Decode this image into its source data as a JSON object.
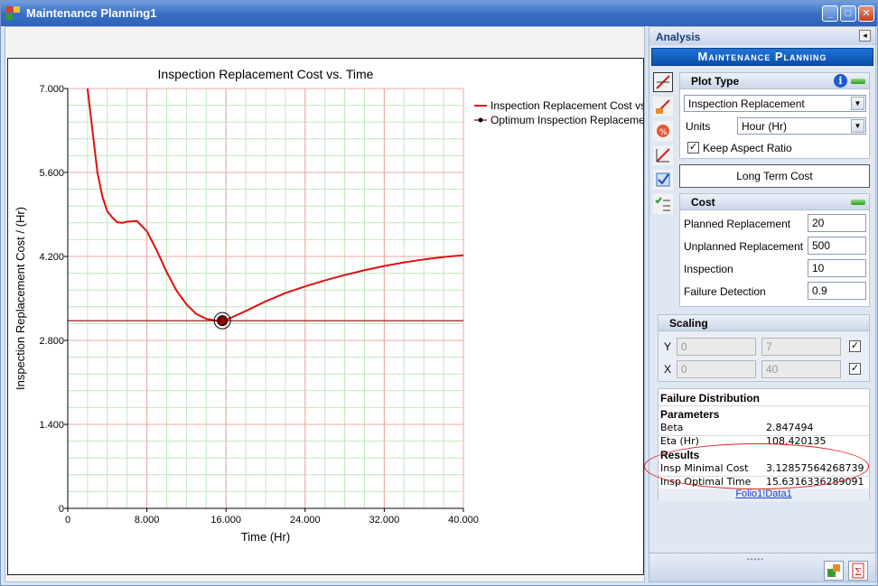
{
  "window": {
    "title": "Maintenance Planning1",
    "minimize": "_",
    "maximize": "□",
    "close": "✕"
  },
  "chart_data": {
    "type": "line",
    "title": "Inspection Replacement Cost vs. Time",
    "xlabel": "Time (Hr)",
    "ylabel": "Inspection Replacement Cost / (Hr)",
    "xlim": [
      0,
      40
    ],
    "ylim": [
      0,
      7
    ],
    "xticks": [
      "0",
      "8.000",
      "16.000",
      "24.000",
      "32.000",
      "40.000"
    ],
    "yticks": [
      "0",
      "1.400",
      "2.800",
      "4.200",
      "5.600",
      "7.000"
    ],
    "grid": true,
    "legend_position": "top-right",
    "series": [
      {
        "name": "Inspection Replacement Cost vs",
        "color": "#e01010",
        "x": [
          2,
          2.5,
          3,
          3.5,
          4,
          4.5,
          5,
          5.5,
          6,
          7,
          8,
          9,
          10,
          11,
          12,
          13,
          14,
          15,
          15.63,
          16,
          18,
          20,
          22,
          24,
          26,
          28,
          30,
          32,
          34,
          36,
          38,
          40
        ],
        "y": [
          7.0,
          6.3,
          5.6,
          5.2,
          4.95,
          4.85,
          4.77,
          4.76,
          4.78,
          4.79,
          4.62,
          4.3,
          3.94,
          3.63,
          3.4,
          3.24,
          3.16,
          3.13,
          3.13,
          3.14,
          3.29,
          3.45,
          3.59,
          3.7,
          3.8,
          3.89,
          3.97,
          4.04,
          4.1,
          4.15,
          4.19,
          4.22
        ]
      },
      {
        "name": "Optimum Inspection Replaceme",
        "color": "#8b0000",
        "x": [
          0,
          40
        ],
        "y": [
          3.1286,
          3.1286
        ],
        "marker": {
          "x": 15.63,
          "y": 3.1286
        }
      }
    ]
  },
  "analysis": {
    "header": "Analysis",
    "pin": "◂",
    "banner": "Maintenance Planning",
    "plot_type": {
      "title": "Plot Type",
      "selected": "Inspection Replacement",
      "units_label": "Units",
      "units_value": "Hour (Hr)",
      "keep_aspect_label": "Keep Aspect Ratio",
      "keep_aspect_checked": "✓"
    },
    "long_term_cost_button": "Long Term Cost",
    "cost": {
      "title": "Cost",
      "planned_label": "Planned Replacement",
      "planned_value": "20",
      "unplanned_label": "Unplanned Replacement",
      "unplanned_value": "500",
      "inspection_label": "Inspection",
      "inspection_value": "10",
      "failure_label": "Failure Detection",
      "failure_value": "0.9"
    },
    "scaling": {
      "title": "Scaling",
      "y_label": "Y",
      "y_min": "0",
      "y_max": "7",
      "y_check": "✓",
      "x_label": "X",
      "x_min": "0",
      "x_max": "40",
      "x_check": "✓"
    },
    "results_panel": {
      "failure_distribution": "Failure Distribution",
      "parameters": "Parameters",
      "beta_label": "Beta",
      "beta_value": "2.847494",
      "eta_label": "Eta (Hr)",
      "eta_value": "108.420135",
      "results": "Results",
      "min_cost_label": "Insp Minimal Cost",
      "min_cost_value": "3.12857564268739",
      "opt_time_label": "Insp Optimal Time",
      "opt_time_value": "15.6316336289091",
      "link": "Folio1!Data1"
    }
  }
}
